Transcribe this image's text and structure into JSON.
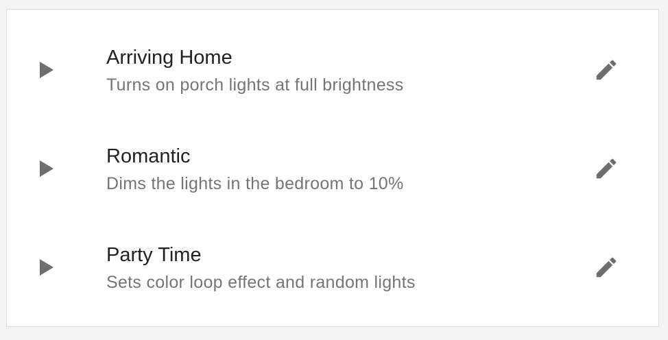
{
  "scenes": [
    {
      "title": "Arriving Home",
      "description": "Turns on porch lights at full brightness",
      "play_icon": "play-arrow-icon",
      "edit_icon": "pencil-icon"
    },
    {
      "title": "Romantic",
      "description": "Dims the lights in the bedroom to 10%",
      "play_icon": "play-arrow-icon",
      "edit_icon": "pencil-icon"
    },
    {
      "title": "Party Time",
      "description": "Sets color loop effect and random lights",
      "play_icon": "play-arrow-icon",
      "edit_icon": "pencil-icon"
    }
  ],
  "colors": {
    "background": "#f4f4f4",
    "card": "#ffffff",
    "title_text": "#212121",
    "secondary_text": "#757575",
    "icon": "#6e6e6e"
  }
}
